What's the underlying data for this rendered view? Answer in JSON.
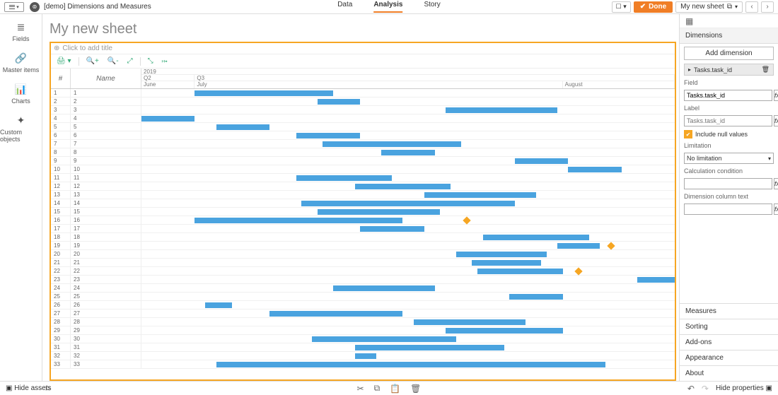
{
  "app": {
    "title": "[demo] Dimensions and Measures"
  },
  "tabs": {
    "data": "Data",
    "analysis": "Analysis",
    "story": "Story",
    "active": "analysis"
  },
  "header": {
    "done": "Done",
    "sheet_name": "My new sheet"
  },
  "left_rail": [
    {
      "icon": "≣",
      "label": "Fields"
    },
    {
      "icon": "🔗",
      "label": "Master items"
    },
    {
      "icon": "📊",
      "label": "Charts"
    },
    {
      "icon": "✦",
      "label": "Custom objects"
    }
  ],
  "sheet": {
    "title": "My new sheet",
    "chart_title_placeholder": "Click to add title"
  },
  "chart_data": {
    "type": "gantt",
    "time_axis": {
      "year": "2019",
      "quarters": [
        {
          "label": "Q2",
          "width_pct": 10
        },
        {
          "label": "Q3",
          "width_pct": 90
        }
      ],
      "months": [
        {
          "label": "June",
          "width_pct": 10
        },
        {
          "label": "July",
          "width_pct": 69
        },
        {
          "label": "August",
          "width_pct": 21
        }
      ]
    },
    "columns": {
      "index": "#",
      "name": "Name"
    },
    "rows": [
      {
        "index": 1,
        "name": "1",
        "bar": {
          "start_pct": 10,
          "width_pct": 26
        }
      },
      {
        "index": 2,
        "name": "2",
        "bar": {
          "start_pct": 33,
          "width_pct": 8
        }
      },
      {
        "index": 3,
        "name": "3",
        "bar": {
          "start_pct": 57,
          "width_pct": 21
        }
      },
      {
        "index": 4,
        "name": "4",
        "bar": {
          "start_pct": 0,
          "width_pct": 10
        }
      },
      {
        "index": 5,
        "name": "5",
        "bar": {
          "start_pct": 14,
          "width_pct": 10
        }
      },
      {
        "index": 6,
        "name": "6",
        "bar": {
          "start_pct": 29,
          "width_pct": 12
        }
      },
      {
        "index": 7,
        "name": "7",
        "bar": {
          "start_pct": 34,
          "width_pct": 26
        }
      },
      {
        "index": 8,
        "name": "8",
        "bar": {
          "start_pct": 45,
          "width_pct": 10
        }
      },
      {
        "index": 9,
        "name": "9",
        "bar": {
          "start_pct": 70,
          "width_pct": 10
        }
      },
      {
        "index": 10,
        "name": "10",
        "bar": {
          "start_pct": 80,
          "width_pct": 10
        }
      },
      {
        "index": 11,
        "name": "11",
        "bar": {
          "start_pct": 29,
          "width_pct": 18
        }
      },
      {
        "index": 12,
        "name": "12",
        "bar": {
          "start_pct": 40,
          "width_pct": 18
        }
      },
      {
        "index": 13,
        "name": "13",
        "bar": {
          "start_pct": 53,
          "width_pct": 21
        }
      },
      {
        "index": 14,
        "name": "14",
        "bar": {
          "start_pct": 30,
          "width_pct": 40
        }
      },
      {
        "index": 15,
        "name": "15",
        "bar": {
          "start_pct": 33,
          "width_pct": 23
        }
      },
      {
        "index": 16,
        "name": "16",
        "bar": {
          "start_pct": 10,
          "width_pct": 39
        },
        "milestone_pct": 61
      },
      {
        "index": 17,
        "name": "17",
        "bar": {
          "start_pct": 41,
          "width_pct": 12
        }
      },
      {
        "index": 18,
        "name": "18",
        "bar": {
          "start_pct": 64,
          "width_pct": 20
        }
      },
      {
        "index": 19,
        "name": "19",
        "bar": {
          "start_pct": 78,
          "width_pct": 8
        },
        "milestone_pct": 88
      },
      {
        "index": 20,
        "name": "20",
        "bar": {
          "start_pct": 59,
          "width_pct": 17
        }
      },
      {
        "index": 21,
        "name": "21",
        "bar": {
          "start_pct": 62,
          "width_pct": 13
        }
      },
      {
        "index": 22,
        "name": "22",
        "bar": {
          "start_pct": 63,
          "width_pct": 16
        },
        "milestone_pct": 82
      },
      {
        "index": 23,
        "name": "23",
        "bar": {
          "start_pct": 93,
          "width_pct": 7
        }
      },
      {
        "index": 24,
        "name": "24",
        "bar": {
          "start_pct": 36,
          "width_pct": 19
        }
      },
      {
        "index": 25,
        "name": "25",
        "bar": {
          "start_pct": 69,
          "width_pct": 10
        }
      },
      {
        "index": 26,
        "name": "26",
        "bar": {
          "start_pct": 12,
          "width_pct": 5
        }
      },
      {
        "index": 27,
        "name": "27",
        "bar": {
          "start_pct": 24,
          "width_pct": 25
        }
      },
      {
        "index": 28,
        "name": "28",
        "bar": {
          "start_pct": 51,
          "width_pct": 21
        }
      },
      {
        "index": 29,
        "name": "29",
        "bar": {
          "start_pct": 57,
          "width_pct": 22
        }
      },
      {
        "index": 30,
        "name": "30",
        "bar": {
          "start_pct": 32,
          "width_pct": 27
        }
      },
      {
        "index": 31,
        "name": "31",
        "bar": {
          "start_pct": 40,
          "width_pct": 28
        }
      },
      {
        "index": 32,
        "name": "32",
        "bar": {
          "start_pct": 40,
          "width_pct": 4
        }
      },
      {
        "index": 33,
        "name": "33",
        "bar": {
          "start_pct": 14,
          "width_pct": 73
        }
      }
    ]
  },
  "props": {
    "section": "Dimensions",
    "add_dimension": "Add dimension",
    "dimension_item": "Tasks.task_id",
    "labels": {
      "field": "Field",
      "label": "Label",
      "include_null": "Include null values",
      "limitation": "Limitation",
      "calc_condition": "Calculation condition",
      "dim_col_text": "Dimension column text"
    },
    "field_value": "Tasks.task_id",
    "label_placeholder": "Tasks.task_id",
    "limitation_value": "No limitation",
    "accordion": [
      "Measures",
      "Sorting",
      "Add-ons",
      "Appearance",
      "About"
    ]
  },
  "status": {
    "hide_assets": "Hide assets",
    "hide_properties": "Hide properties"
  }
}
